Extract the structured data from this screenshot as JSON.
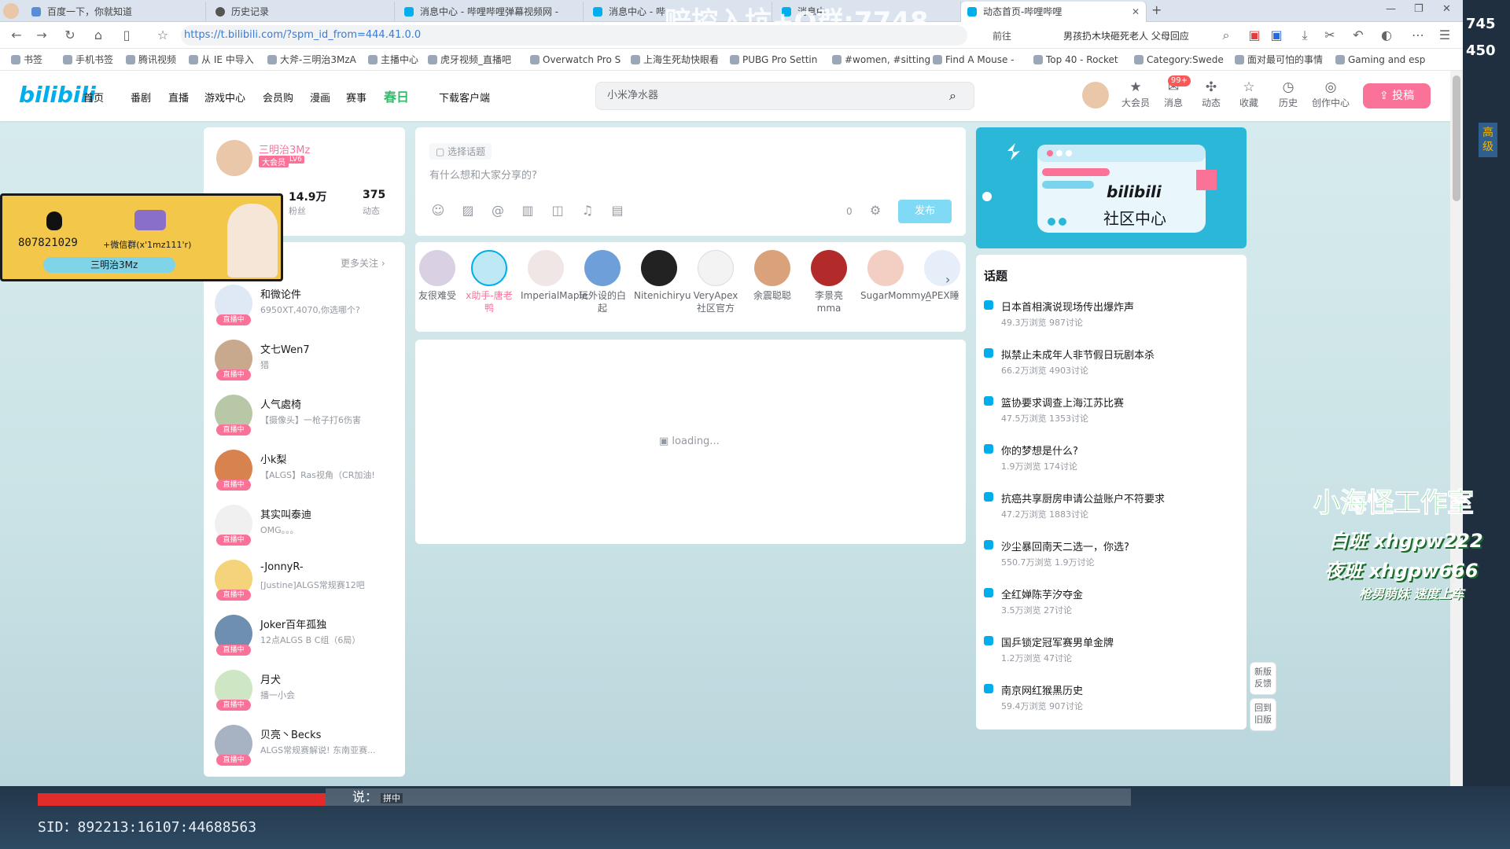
{
  "browser": {
    "tabs": [
      {
        "label": "百度一下，你就知道"
      },
      {
        "label": "历史记录"
      },
      {
        "label": "消息中心 - 哔哩哔哩弹幕视频网 -"
      },
      {
        "label": "消息中心 - 哔"
      },
      {
        "label": "消息中"
      },
      {
        "label": "动态首页-哔哩哔哩"
      }
    ],
    "url": "https://t.bilibili.com/?spm_id_from=444.41.0.0",
    "forward_label": "前往",
    "news_text": "男孩扔木块砸死老人 父母回应",
    "bookmarks": [
      "书签",
      "手机书签",
      "腾讯视频",
      "从 IE 中导入",
      "大斧-三明治3MzA",
      "主播中心",
      "虎牙视频_直播吧",
      "Overwatch Pro S",
      "上海生死劫快眼看",
      "PUBG Pro Settin",
      "#women, #sitting",
      "Find A Mouse -",
      "Top 40 - Rocket",
      "Category:Swede",
      "面对最可怕的事情",
      "Gaming and esp"
    ]
  },
  "header": {
    "logo": "bilibili",
    "nav": [
      "首页",
      "番剧",
      "直播",
      "游戏中心",
      "会员购",
      "漫画",
      "赛事",
      "春日",
      "下载客户端"
    ],
    "search_placeholder": "小米净水器",
    "icons": [
      {
        "label": "大会员",
        "glyph": "★"
      },
      {
        "label": "消息",
        "glyph": "✉",
        "badge": "99+"
      },
      {
        "label": "动态",
        "glyph": "✣"
      },
      {
        "label": "收藏",
        "glyph": "☆"
      },
      {
        "label": "历史",
        "glyph": "◷"
      },
      {
        "label": "创作中心",
        "glyph": "◎"
      }
    ],
    "upload_label": "投稿"
  },
  "profile": {
    "name": "三明治3Mz",
    "vip": "大会员",
    "level": "LV6",
    "fans_count": "14.9万",
    "fans_label": "粉丝",
    "posts_count": "375",
    "posts_label": "动态"
  },
  "following": {
    "more_label": "更多关注",
    "items": [
      {
        "name": "和微论件",
        "sub": "6950XT,4070,你选哪个?"
      },
      {
        "name": "文七Wen7",
        "sub": "猎"
      },
      {
        "name": "人气處椅",
        "sub": "【摄像头】一枪子打6伤害"
      },
      {
        "name": "小k梨",
        "sub": "【ALGS】Ras视角（CR加油!"
      },
      {
        "name": "其实叫泰迪",
        "sub": "OMG。。。"
      },
      {
        "name": "-JonnyR-",
        "sub": "[Justine]ALGS常规赛12吧"
      },
      {
        "name": "Joker百年孤独",
        "sub": "12点ALGS B C组（6局）"
      },
      {
        "name": "月犬",
        "sub": "播一小会"
      },
      {
        "name": "贝亮丶Becks",
        "sub": "ALGS常规赛解说! 东南亚赛..."
      }
    ],
    "live_label": "直播中"
  },
  "composer": {
    "topic_label": "选择话题",
    "placeholder": "有什么想和大家分享的?",
    "count": "0",
    "publish_label": "发布",
    "tools": [
      "emoji-icon",
      "image-icon",
      "at-icon",
      "vote-icon",
      "gift-icon",
      "bell-icon",
      "reserve-icon"
    ]
  },
  "ups": [
    {
      "name": "友很难受"
    },
    {
      "name": "x助手-唐老鸭"
    },
    {
      "name": "ImperialMaple"
    },
    {
      "name": "玩外设的白起"
    },
    {
      "name": "Nitenichiryu"
    },
    {
      "name": "VeryApex社区官方"
    },
    {
      "name": "余震聪聪"
    },
    {
      "name": "李景亮mma"
    },
    {
      "name": "SugarMommy_"
    },
    {
      "name": "APEX睡"
    }
  ],
  "feed": {
    "loading": "loading..."
  },
  "banner": {
    "brand": "bilibili",
    "title": "社区中心"
  },
  "topics": {
    "heading": "话题",
    "items": [
      {
        "title": "日本首相演说现场传出爆炸声",
        "meta": "49.3万浏览 987讨论"
      },
      {
        "title": "拟禁止未成年人非节假日玩剧本杀",
        "meta": "66.2万浏览 4903讨论"
      },
      {
        "title": "篮协要求调查上海江苏比赛",
        "meta": "47.5万浏览 1353讨论"
      },
      {
        "title": "你的梦想是什么?",
        "meta": "1.9万浏览 174讨论"
      },
      {
        "title": "抗癌共享厨房申请公益账户不符要求",
        "meta": "47.2万浏览 1883讨论"
      },
      {
        "title": "沙尘暴回南天二选一，你选?",
        "meta": "550.7万浏览 1.9万讨论"
      },
      {
        "title": "全红婵陈芋汐夺金",
        "meta": "3.5万浏览 27讨论"
      },
      {
        "title": "国乒锁定冠军赛男单金牌",
        "meta": "1.2万浏览 47讨论"
      },
      {
        "title": "南京网红猴黑历史",
        "meta": "59.4万浏览 907讨论"
      }
    ]
  },
  "side_buttons": [
    "新版反馈",
    "回到旧版"
  ],
  "overlay": {
    "qq": "807821029",
    "wechat": "+微信群(x'1mz111'r)",
    "name": "三明治3Mz",
    "studio_title": "小海怪工作室",
    "day": "白班 xhgpw222",
    "night": "夜班 xhgpw666",
    "slogan": "枪男萌妹 速度上车",
    "watermark": "赔控入坑+Q群:7748",
    "right_numbers": [
      "745",
      "450"
    ],
    "right_label": "高级"
  },
  "stream": {
    "chat_prefix": "说：",
    "ime": "拼中",
    "sid": "SID：892213:16107:44688563"
  }
}
